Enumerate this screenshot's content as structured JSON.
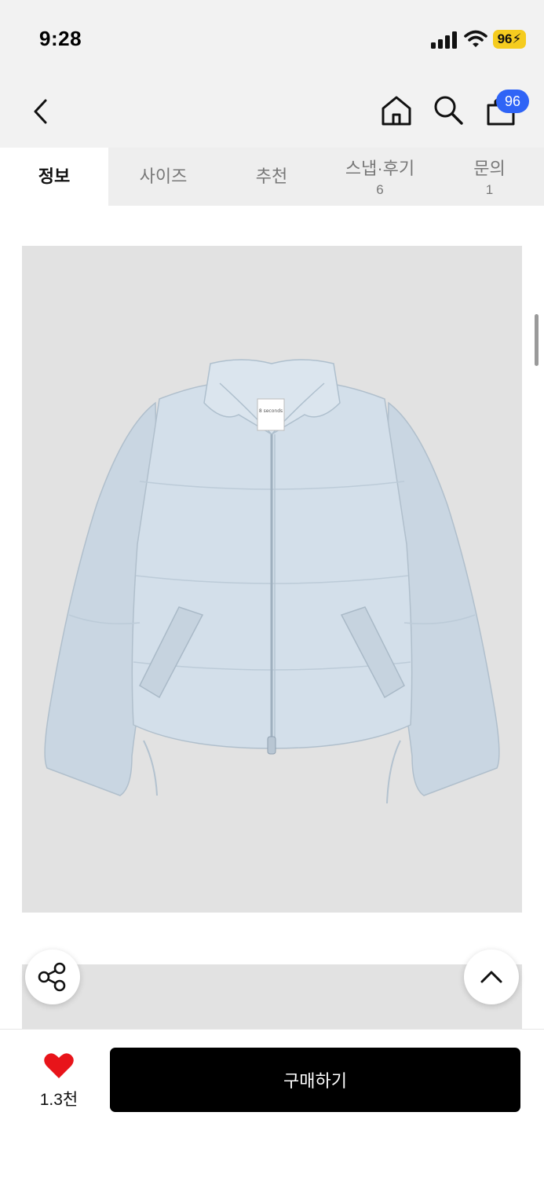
{
  "status": {
    "time": "9:28",
    "battery": "96"
  },
  "header": {
    "cart_count": "96"
  },
  "tabs": [
    {
      "label": "정보",
      "count": ""
    },
    {
      "label": "사이즈",
      "count": ""
    },
    {
      "label": "추천",
      "count": ""
    },
    {
      "label": "스냅·후기",
      "count": "6"
    },
    {
      "label": "문의",
      "count": "1"
    }
  ],
  "product": {
    "tag_text": "8 seconds"
  },
  "bottom": {
    "like_count": "1.3천",
    "buy_label": "구매하기"
  },
  "colors": {
    "accent": "#2f64f6",
    "battery": "#f5cc1f",
    "like": "#e8141a",
    "jacket": "#cfdbe6"
  }
}
